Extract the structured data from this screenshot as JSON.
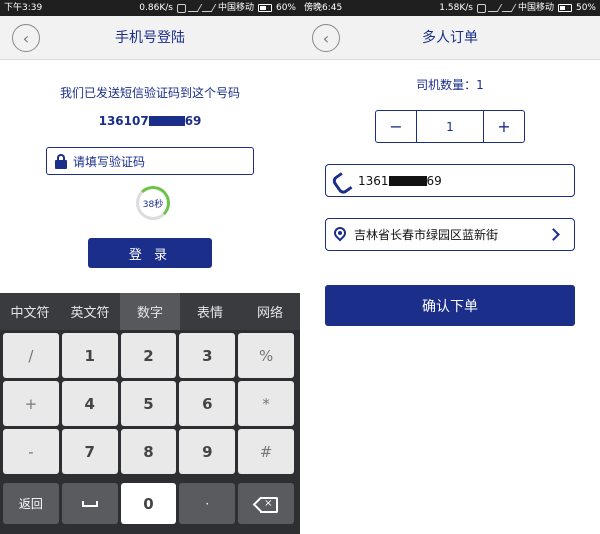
{
  "left": {
    "status": {
      "time": "下午3:39",
      "speed": "0.86K/s",
      "carrier": "中国移动",
      "battery": "60%",
      "battery_level": 0.6
    },
    "nav": {
      "title": "手机号登陆",
      "back_icon": "chevron-left-icon"
    },
    "message": "我们已发送短信验证码到这个号码",
    "phone_prefix": "136107",
    "phone_suffix": "69",
    "code_input": {
      "placeholder": "请填写验证码",
      "icon": "lock-icon"
    },
    "countdown": "38秒",
    "login_label": "登 录",
    "keyboard": {
      "tabs": [
        "中文符",
        "英文符",
        "数字",
        "表情",
        "网络"
      ],
      "active_tab": "数字",
      "rows": [
        [
          "/",
          "1",
          "2",
          "3",
          "%"
        ],
        [
          "+",
          "4",
          "5",
          "6",
          "*"
        ],
        [
          "-",
          "7",
          "8",
          "9",
          "#"
        ]
      ],
      "bottom": {
        "back": "返回",
        "zero": "0",
        "dot": "·"
      }
    }
  },
  "right": {
    "status": {
      "time": "傍晚6:45",
      "speed": "1.58K/s",
      "carrier": "中国移动",
      "battery": "50%",
      "battery_level": 0.5
    },
    "nav": {
      "title": "多人订单",
      "back_icon": "chevron-left-icon"
    },
    "driver_count": "司机数量：1",
    "stepper": {
      "minus": "−",
      "value": "1",
      "plus": "+"
    },
    "phone": {
      "prefix": "1361",
      "suffix": "69",
      "icon": "phone-icon"
    },
    "address": {
      "text": "吉林省长春市绿园区蓝新街",
      "icon": "location-pin-icon"
    },
    "confirm_label": "确认下单"
  }
}
